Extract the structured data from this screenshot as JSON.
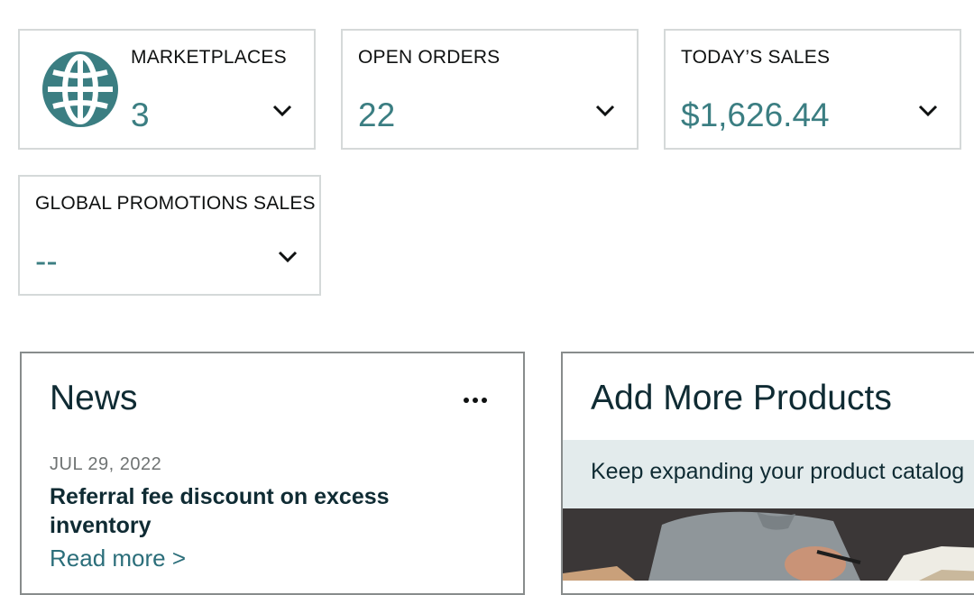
{
  "metrics": {
    "marketplaces": {
      "title": "MARKETPLACES",
      "value": "3",
      "icon": "globe-icon"
    },
    "open_orders": {
      "title": "OPEN ORDERS",
      "value": "22"
    },
    "todays_sales": {
      "title": "TODAY’S SALES",
      "value": "$1,626.44"
    },
    "global_promotions": {
      "title": "GLOBAL PROMOTIONS SALES",
      "value": "--"
    }
  },
  "news": {
    "title": "News",
    "date": "JUL 29, 2022",
    "headline": "Referral fee discount on excess inventory",
    "read_more": "Read more >"
  },
  "add_products": {
    "title": "Add More Products",
    "banner": "Keep expanding your product catalog"
  },
  "colors": {
    "accent_teal": "#3b7e82",
    "link": "#2b6e7a",
    "card_border": "#d5d9d9",
    "banner_bg": "#e3ebec"
  }
}
